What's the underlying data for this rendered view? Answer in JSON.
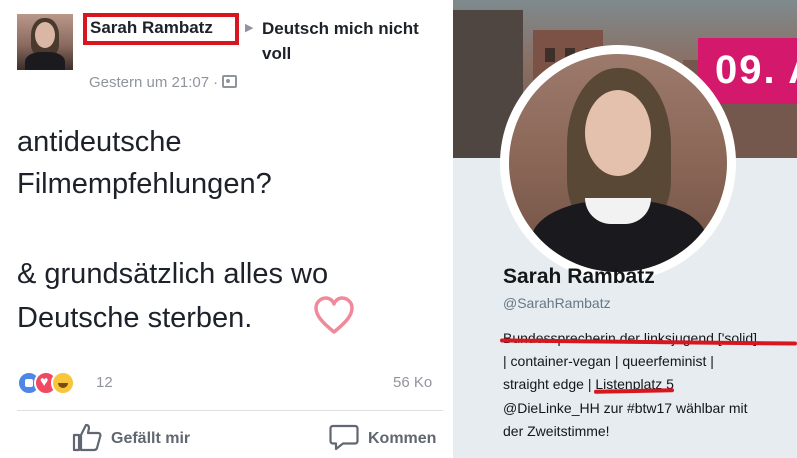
{
  "facebook_post": {
    "author_name": "Sarah Rambatz",
    "group_name": "Deutsch mich nicht voll",
    "timestamp": "Gestern um 21:07",
    "meta_separator": "·",
    "text_line1": "antideutsche",
    "text_line2": "Filmempfehlungen?",
    "text_line3": "& grundsätzlich alles wo",
    "text_line4": "Deutsche sterben.",
    "reaction_count": "12",
    "comment_count": "56 Ko",
    "like_label": "Gefällt mir",
    "comment_label": "Kommen",
    "highlight_color": "#d8161f"
  },
  "twitter_profile": {
    "header_sign_text": "09. A",
    "name": "Sarah Rambatz",
    "handle": "@SarahRambatz",
    "bio_line1": "Bundessprecherin der linksjugend ['solid]",
    "bio_line2": "| container-vegan | queerfeminist |",
    "bio_line3": "straight edge | Listenplatz 5",
    "bio_line4": "@DieLinke_HH zur #btw17 wählbar mit",
    "bio_line5": "der Zweitstimme!"
  }
}
